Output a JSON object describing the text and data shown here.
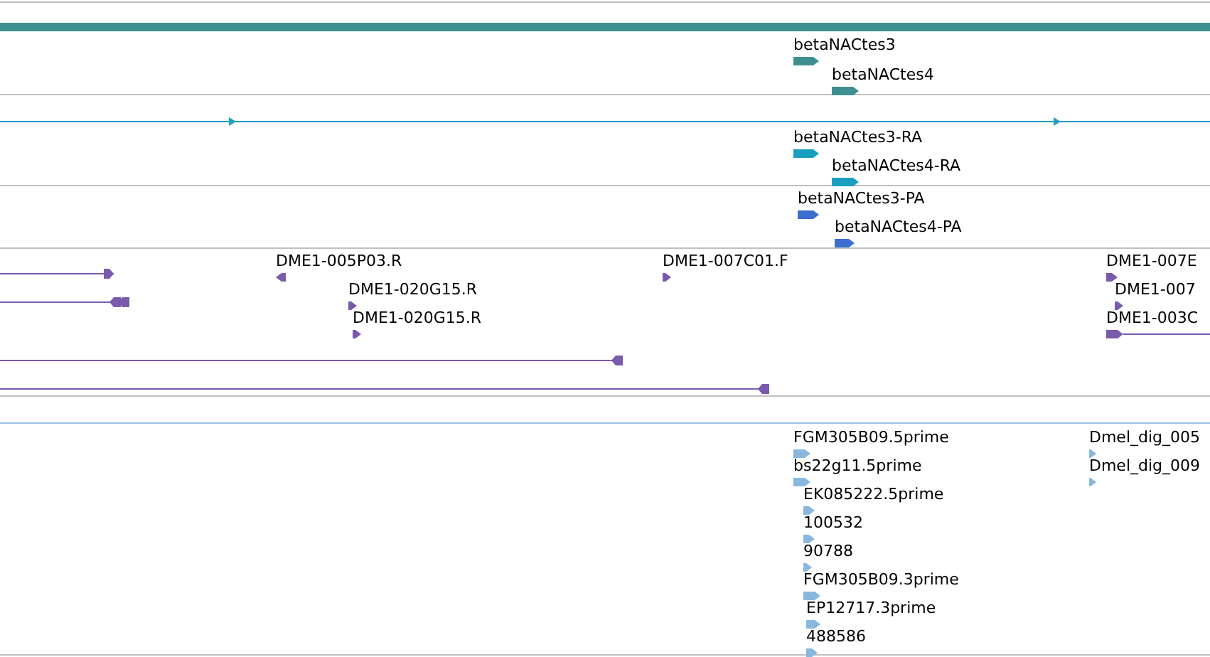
{
  "tracks": [
    {
      "kind": "gene",
      "features": [
        {
          "label": "betaNACtes3",
          "kind": "forward"
        },
        {
          "label": "betaNACtes4",
          "kind": "forward"
        }
      ]
    },
    {
      "kind": "transcript",
      "features": [
        {
          "label": "betaNACtes3-RA",
          "kind": "forward"
        },
        {
          "label": "betaNACtes4-RA",
          "kind": "forward"
        }
      ]
    },
    {
      "kind": "protein",
      "features": [
        {
          "label": "betaNACtes3-PA",
          "kind": "forward"
        },
        {
          "label": "betaNACtes4-PA",
          "kind": "forward"
        }
      ]
    },
    {
      "kind": "clone",
      "features": [
        {
          "label": "DME1-005P03.R",
          "kind": "reverse"
        },
        {
          "label": "DME1-020G15.R",
          "kind": "forward"
        },
        {
          "label": "DME1-020G15.R",
          "kind": "forward"
        },
        {
          "label": "DME1-007C01.F",
          "kind": "forward"
        },
        {
          "label": "DME1-007E",
          "kind": "forward"
        },
        {
          "label": "DME1-007",
          "kind": "forward"
        },
        {
          "label": "DME1-003C",
          "kind": "forward"
        }
      ]
    },
    {
      "kind": "est",
      "features": [
        {
          "label": "FGM305B09.5prime",
          "kind": "forward"
        },
        {
          "label": "bs22g11.5prime",
          "kind": "forward"
        },
        {
          "label": "EK085222.5prime",
          "kind": "forward"
        },
        {
          "label": "100532",
          "kind": "forward"
        },
        {
          "label": "90788",
          "kind": "forward"
        },
        {
          "label": "FGM305B09.3prime",
          "kind": "forward"
        },
        {
          "label": "EP12717.3prime",
          "kind": "forward"
        },
        {
          "label": "488586",
          "kind": "forward"
        },
        {
          "label": "Dmel_dig_005",
          "kind": "forward"
        },
        {
          "label": "Dmel_dig_009",
          "kind": "forward"
        }
      ]
    }
  ]
}
